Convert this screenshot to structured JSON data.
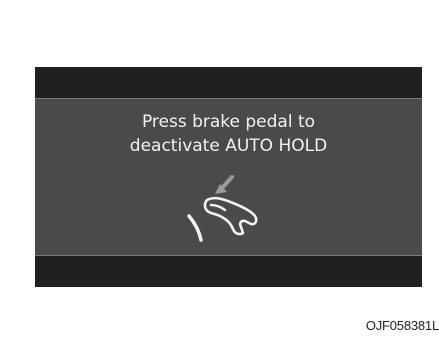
{
  "display": {
    "message_line1": "Press brake pedal to",
    "message_line2": "deactivate AUTO HOLD",
    "icon": "brake-pedal-press-icon"
  },
  "figure_code": "OJF058381L",
  "colors": {
    "screen_background": "#4a4a4a",
    "bar_background": "#202020",
    "text": "#f2f2f2",
    "icon_stroke": "#f2f2f2",
    "arrow": "#9a9a9a"
  }
}
